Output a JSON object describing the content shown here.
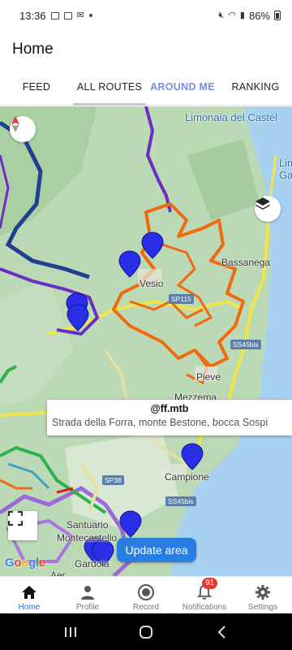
{
  "status_bar": {
    "time": "13:36",
    "battery_pct": "86%"
  },
  "app_bar": {
    "title": "Home"
  },
  "tabs": [
    {
      "label": "FEED"
    },
    {
      "label": "ALL ROUTES"
    },
    {
      "label": "AROUND ME"
    },
    {
      "label": "RANKING"
    }
  ],
  "map": {
    "labels": {
      "limonaia": "Limonaia del Castèl",
      "limone": "Limo\nGa",
      "bassanega": "Bassanega",
      "vesio": "Vesio",
      "pieve": "Pieve",
      "mezzema": "Mezzema",
      "campione": "Campione",
      "santuario": "Santuario",
      "montecastello": "Montecastello",
      "gardola": "Gardola",
      "aer": "Aer"
    },
    "road_badges": {
      "sp115": "SP115",
      "ss45bis_1": "SS45bis",
      "sp38": "SP38",
      "ss45bis_2": "SS45bis"
    },
    "info_card": {
      "user": "@ff.mtb",
      "description": "Strada della Forra, monte Bestone, bocca Sospi"
    },
    "update_button": "Update area",
    "attribution": "Google",
    "colors": {
      "route_orange": "#f06a10",
      "route_purple": "#6a2fc0",
      "route_navy": "#1f3f8f",
      "route_yellow": "#f0e64a",
      "route_green": "#2bb24a",
      "marker": "#2a2ee6",
      "lake": "#a8d0f0"
    }
  },
  "bottom_nav": [
    {
      "label": "Home",
      "icon": "home-icon",
      "active": true
    },
    {
      "label": "Profile",
      "icon": "person-icon"
    },
    {
      "label": "Record",
      "icon": "record-icon"
    },
    {
      "label": "Notifications",
      "icon": "bell-icon",
      "badge": "91"
    },
    {
      "label": "Settings",
      "icon": "gear-icon"
    }
  ]
}
